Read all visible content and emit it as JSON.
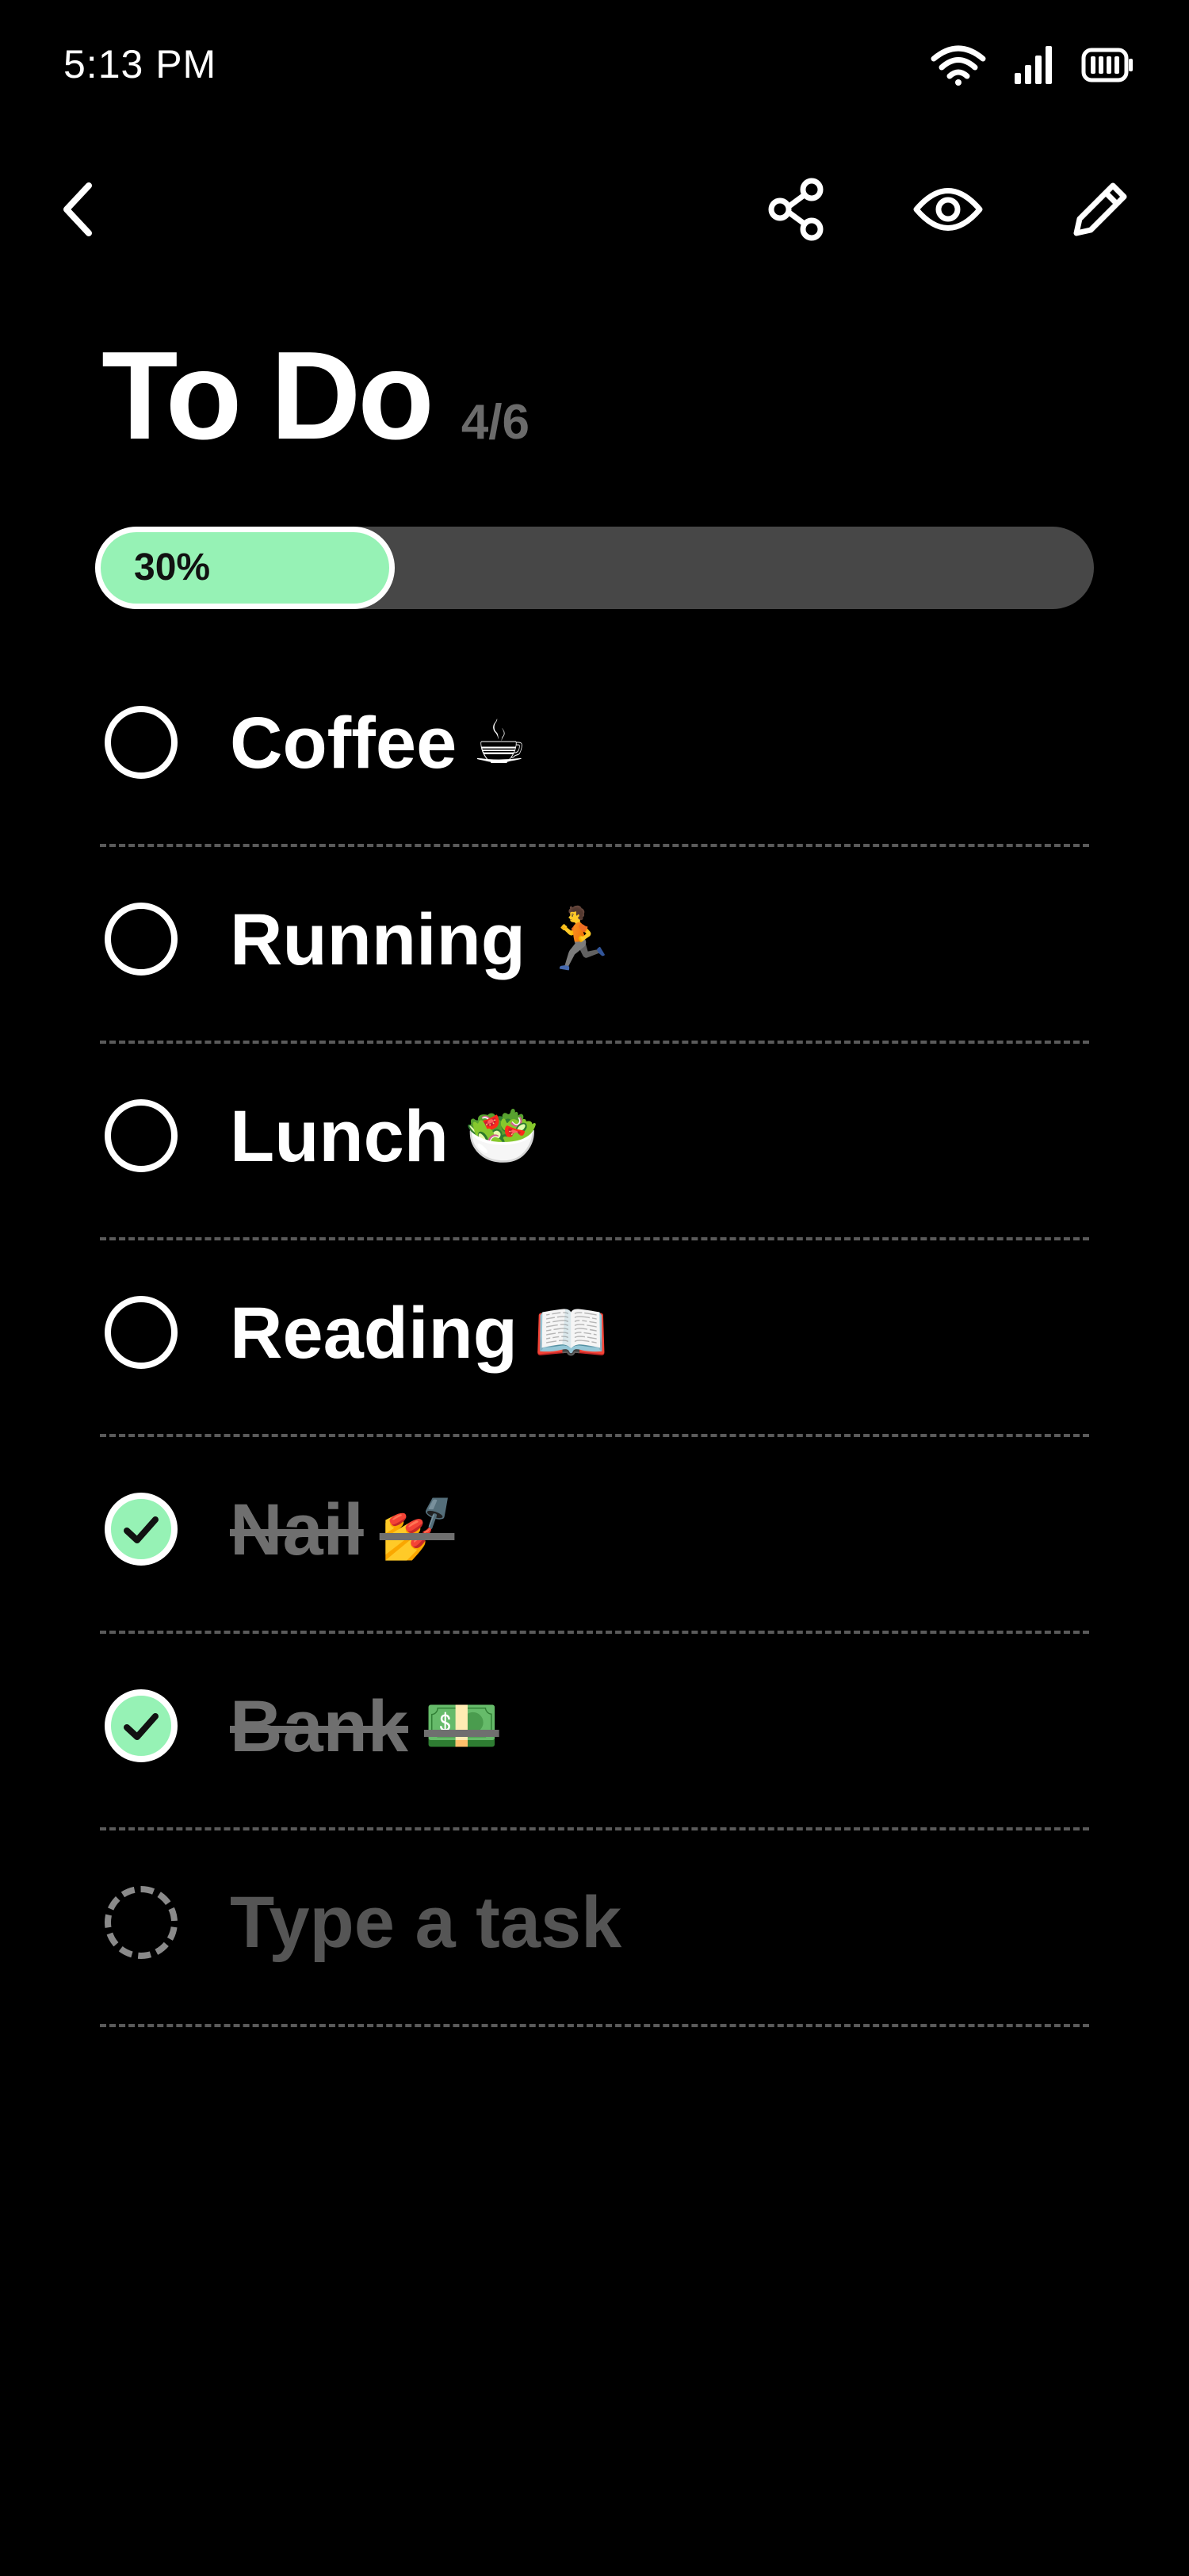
{
  "status_bar": {
    "time": "5:13 PM",
    "icons": [
      "wifi-icon",
      "cellular-signal-icon",
      "battery-icon"
    ]
  },
  "toolbar": {
    "back_icon": "chevron-left-icon",
    "share_icon": "share-icon",
    "preview_icon": "eye-icon",
    "edit_icon": "pencil-icon"
  },
  "header": {
    "title": "To Do",
    "count": "4/6"
  },
  "progress": {
    "label": "30%",
    "fraction": 0.3,
    "fill_color": "#96f2b5",
    "track_color": "#474747"
  },
  "tasks": [
    {
      "label": "Coffee",
      "emoji": "☕",
      "done": false
    },
    {
      "label": "Running",
      "emoji": "🏃",
      "done": false
    },
    {
      "label": "Lunch",
      "emoji": "🥗",
      "done": false
    },
    {
      "label": "Reading",
      "emoji": "📖",
      "done": false
    },
    {
      "label": "Nail",
      "emoji": "💅",
      "done": true
    },
    {
      "label": "Bank",
      "emoji": "💵",
      "done": true
    }
  ],
  "new_task": {
    "placeholder": "Type a task"
  },
  "colors": {
    "background": "#000000",
    "accent": "#96f2b5",
    "done_text": "#6f6f6f"
  }
}
